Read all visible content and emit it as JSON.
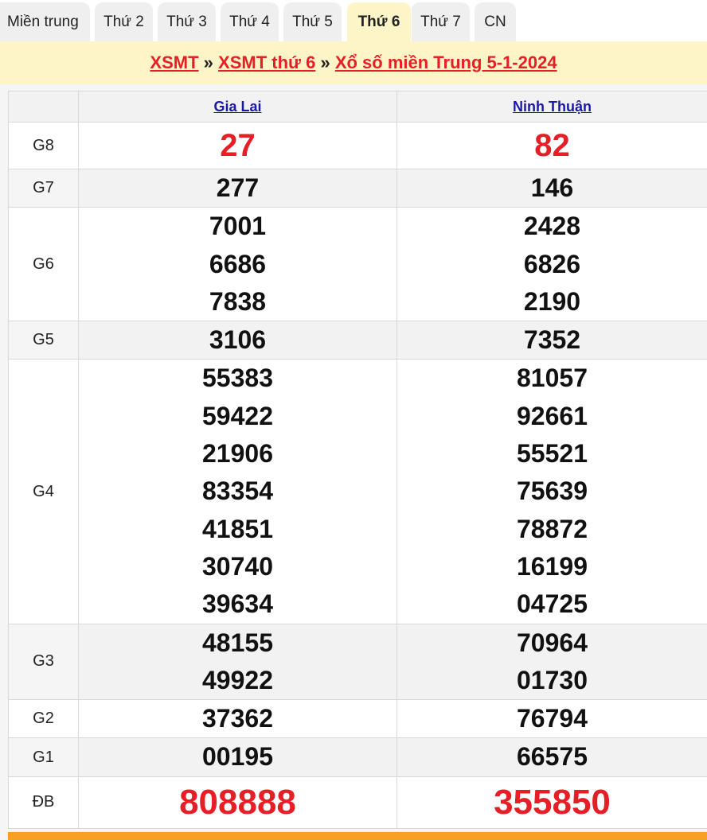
{
  "tabs": [
    "Miền trung",
    "Thứ 2",
    "Thứ 3",
    "Thứ 4",
    "Thứ 5",
    "Thứ 6",
    "Thứ 7",
    "CN"
  ],
  "active_tab": "Thứ 6",
  "breadcrumb": {
    "link1": "XSMT",
    "sep": "»",
    "link2": "XSMT thứ 6",
    "link3": "Xổ số miền Trung 5-1-2024"
  },
  "provinces": [
    "Gia Lai",
    "Ninh Thuận"
  ],
  "prizes": [
    {
      "label": "G8",
      "a": [
        "27"
      ],
      "b": [
        "82"
      ]
    },
    {
      "label": "G7",
      "a": [
        "277"
      ],
      "b": [
        "146"
      ]
    },
    {
      "label": "G6",
      "a": [
        "7001",
        "6686",
        "7838"
      ],
      "b": [
        "2428",
        "6826",
        "2190"
      ]
    },
    {
      "label": "G5",
      "a": [
        "3106"
      ],
      "b": [
        "7352"
      ]
    },
    {
      "label": "G4",
      "a": [
        "55383",
        "59422",
        "21906",
        "83354",
        "41851",
        "30740",
        "39634"
      ],
      "b": [
        "81057",
        "92661",
        "55521",
        "75639",
        "78872",
        "16199",
        "04725"
      ]
    },
    {
      "label": "G3",
      "a": [
        "48155",
        "49922"
      ],
      "b": [
        "70964",
        "01730"
      ]
    },
    {
      "label": "G2",
      "a": [
        "37362"
      ],
      "b": [
        "76794"
      ]
    },
    {
      "label": "G1",
      "a": [
        "00195"
      ],
      "b": [
        "66575"
      ]
    },
    {
      "label": "ĐB",
      "a": [
        "808888"
      ],
      "b": [
        "355850"
      ]
    }
  ],
  "colors": {
    "accent_red": "#e61f26",
    "header_bg": "#fdf4c7",
    "link_blue": "#1a1aa6",
    "bottom_bar": "#f6a123"
  }
}
